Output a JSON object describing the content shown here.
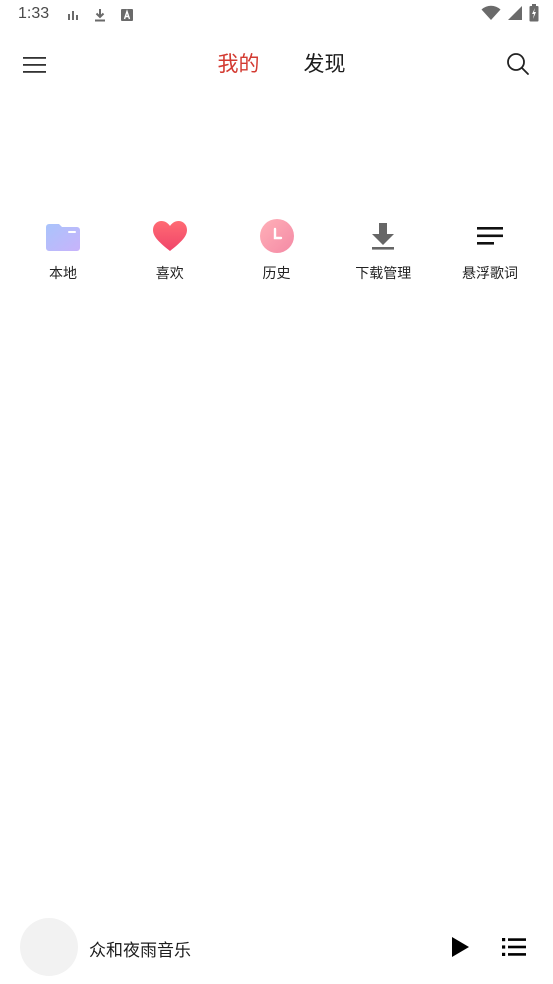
{
  "status_bar": {
    "time": "1:33",
    "icons": [
      "bar-chart-icon",
      "download-icon",
      "font-icon",
      "wifi-icon",
      "signal-icon",
      "battery-icon"
    ]
  },
  "top_bar": {
    "menu_icon": "hamburger-menu-icon",
    "tabs": [
      {
        "label": "我的",
        "active": true
      },
      {
        "label": "发现",
        "active": false
      }
    ],
    "search_icon": "search-icon"
  },
  "shortcuts": [
    {
      "label": "本地",
      "icon": "folder-icon"
    },
    {
      "label": "喜欢",
      "icon": "heart-icon"
    },
    {
      "label": "历史",
      "icon": "clock-icon"
    },
    {
      "label": "下载管理",
      "icon": "download-icon"
    },
    {
      "label": "悬浮歌词",
      "icon": "lyrics-icon"
    }
  ],
  "player": {
    "track_title": "众和夜雨音乐",
    "play_icon": "play-icon",
    "playlist_icon": "playlist-icon"
  },
  "colors": {
    "accent": "#d33a31",
    "folder": "#b7b4fb",
    "heart": "#f5516b",
    "clock": "#f7a1b0",
    "album_placeholder": "#f2f2f2"
  }
}
